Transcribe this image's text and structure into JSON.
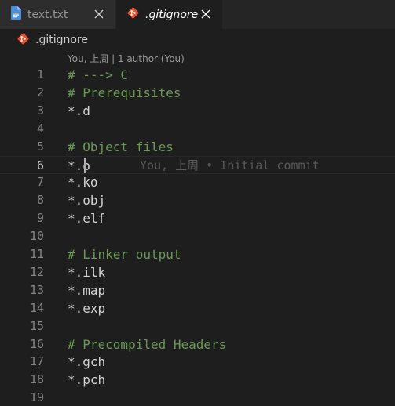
{
  "tabs": [
    {
      "label": "text.txt",
      "icon": "file-icon"
    },
    {
      "label": ".gitignore",
      "icon": "git-icon"
    }
  ],
  "breadcrumb": {
    "label": ".gitignore"
  },
  "codelens": "You, 上周 | 1 author (You)",
  "blame": "You, 上周 • Initial commit",
  "colors": {
    "git": "#e8512f",
    "file": "#4a8fdb",
    "comment": "#6a9955"
  },
  "lines": [
    {
      "n": "1",
      "text": "# ---> C",
      "comment": true
    },
    {
      "n": "2",
      "text": "# Prerequisites",
      "comment": true
    },
    {
      "n": "3",
      "text": "*.d",
      "comment": false
    },
    {
      "n": "4",
      "text": "",
      "comment": false
    },
    {
      "n": "5",
      "text": "# Object files",
      "comment": true
    },
    {
      "n": "6",
      "text": "*.o",
      "comment": false
    },
    {
      "n": "7",
      "text": "*.ko",
      "comment": false
    },
    {
      "n": "8",
      "text": "*.obj",
      "comment": false
    },
    {
      "n": "9",
      "text": "*.elf",
      "comment": false
    },
    {
      "n": "10",
      "text": "",
      "comment": false
    },
    {
      "n": "11",
      "text": "# Linker output",
      "comment": true
    },
    {
      "n": "12",
      "text": "*.ilk",
      "comment": false
    },
    {
      "n": "13",
      "text": "*.map",
      "comment": false
    },
    {
      "n": "14",
      "text": "*.exp",
      "comment": false
    },
    {
      "n": "15",
      "text": "",
      "comment": false
    },
    {
      "n": "16",
      "text": "# Precompiled Headers",
      "comment": true
    },
    {
      "n": "17",
      "text": "*.gch",
      "comment": false
    },
    {
      "n": "18",
      "text": "*.pch",
      "comment": false
    },
    {
      "n": "19",
      "text": "",
      "comment": false
    }
  ],
  "current_line": "6"
}
